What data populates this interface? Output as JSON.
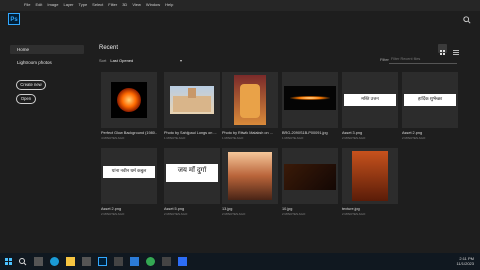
{
  "menu": [
    "File",
    "Edit",
    "Image",
    "Layer",
    "Type",
    "Select",
    "Filter",
    "3D",
    "View",
    "Window",
    "Help"
  ],
  "app": {
    "logo": "Ps"
  },
  "sidebar": {
    "items": [
      {
        "label": "Home"
      },
      {
        "label": "Lightroom photos"
      }
    ],
    "create_new": "Create new",
    "open": "Open"
  },
  "main": {
    "title": "Recent",
    "sort_label": "Sort",
    "sort_value": "Last Opened",
    "filter_label": "Filter",
    "filter_placeholder": "Filter Recent files"
  },
  "files": [
    {
      "name": "Perfect Glow Background (1980...",
      "time": "4 MINUTES AGO",
      "thumb": "glow"
    },
    {
      "name": "Photo by Sahijpaul Longs on ...",
      "time": "1 MINUTE AGO",
      "thumb": "temple"
    },
    {
      "name": "Photo by Ritwik Malaksh on ...",
      "time": "1 MINUTE AGO",
      "thumb": "idol"
    },
    {
      "name": "BRG-2090S1B-P00091.jpg",
      "time": "1 MINUTE AGO",
      "thumb": "streak"
    },
    {
      "name": "Asset 3.png",
      "time": "2 MINUTES AGO",
      "thumb": "text1"
    },
    {
      "name": "Asset 2.png",
      "time": "2 MINUTES AGO",
      "thumb": "text2"
    },
    {
      "name": "Asset 2.png",
      "time": "2 MINUTES AGO",
      "thumb": "text3"
    },
    {
      "name": "Asset 5.png",
      "time": "2 MINUTES AGO",
      "thumb": "text4"
    },
    {
      "name": "13.jpg",
      "time": "2 MINUTES AGO",
      "thumb": "sunset"
    },
    {
      "name": "10.jpg",
      "time": "2 MINUTES AGO",
      "thumb": "dark"
    },
    {
      "name": "texture.jpg",
      "time": "2 MINUTES AGO",
      "thumb": "fire"
    }
  ],
  "thumb_text": {
    "text1": "मस्ति उत्तन",
    "text2": "हार्दिक शुभेच्छा",
    "text3": "यांना नवीन धर्म कबुल",
    "text4": "जय माँ दुर्गा"
  },
  "clock": {
    "time": "2:11 PM",
    "date": "11/1/2023"
  },
  "colors": {
    "accent": "#31a8ff",
    "bg": "#1e1e1e"
  }
}
